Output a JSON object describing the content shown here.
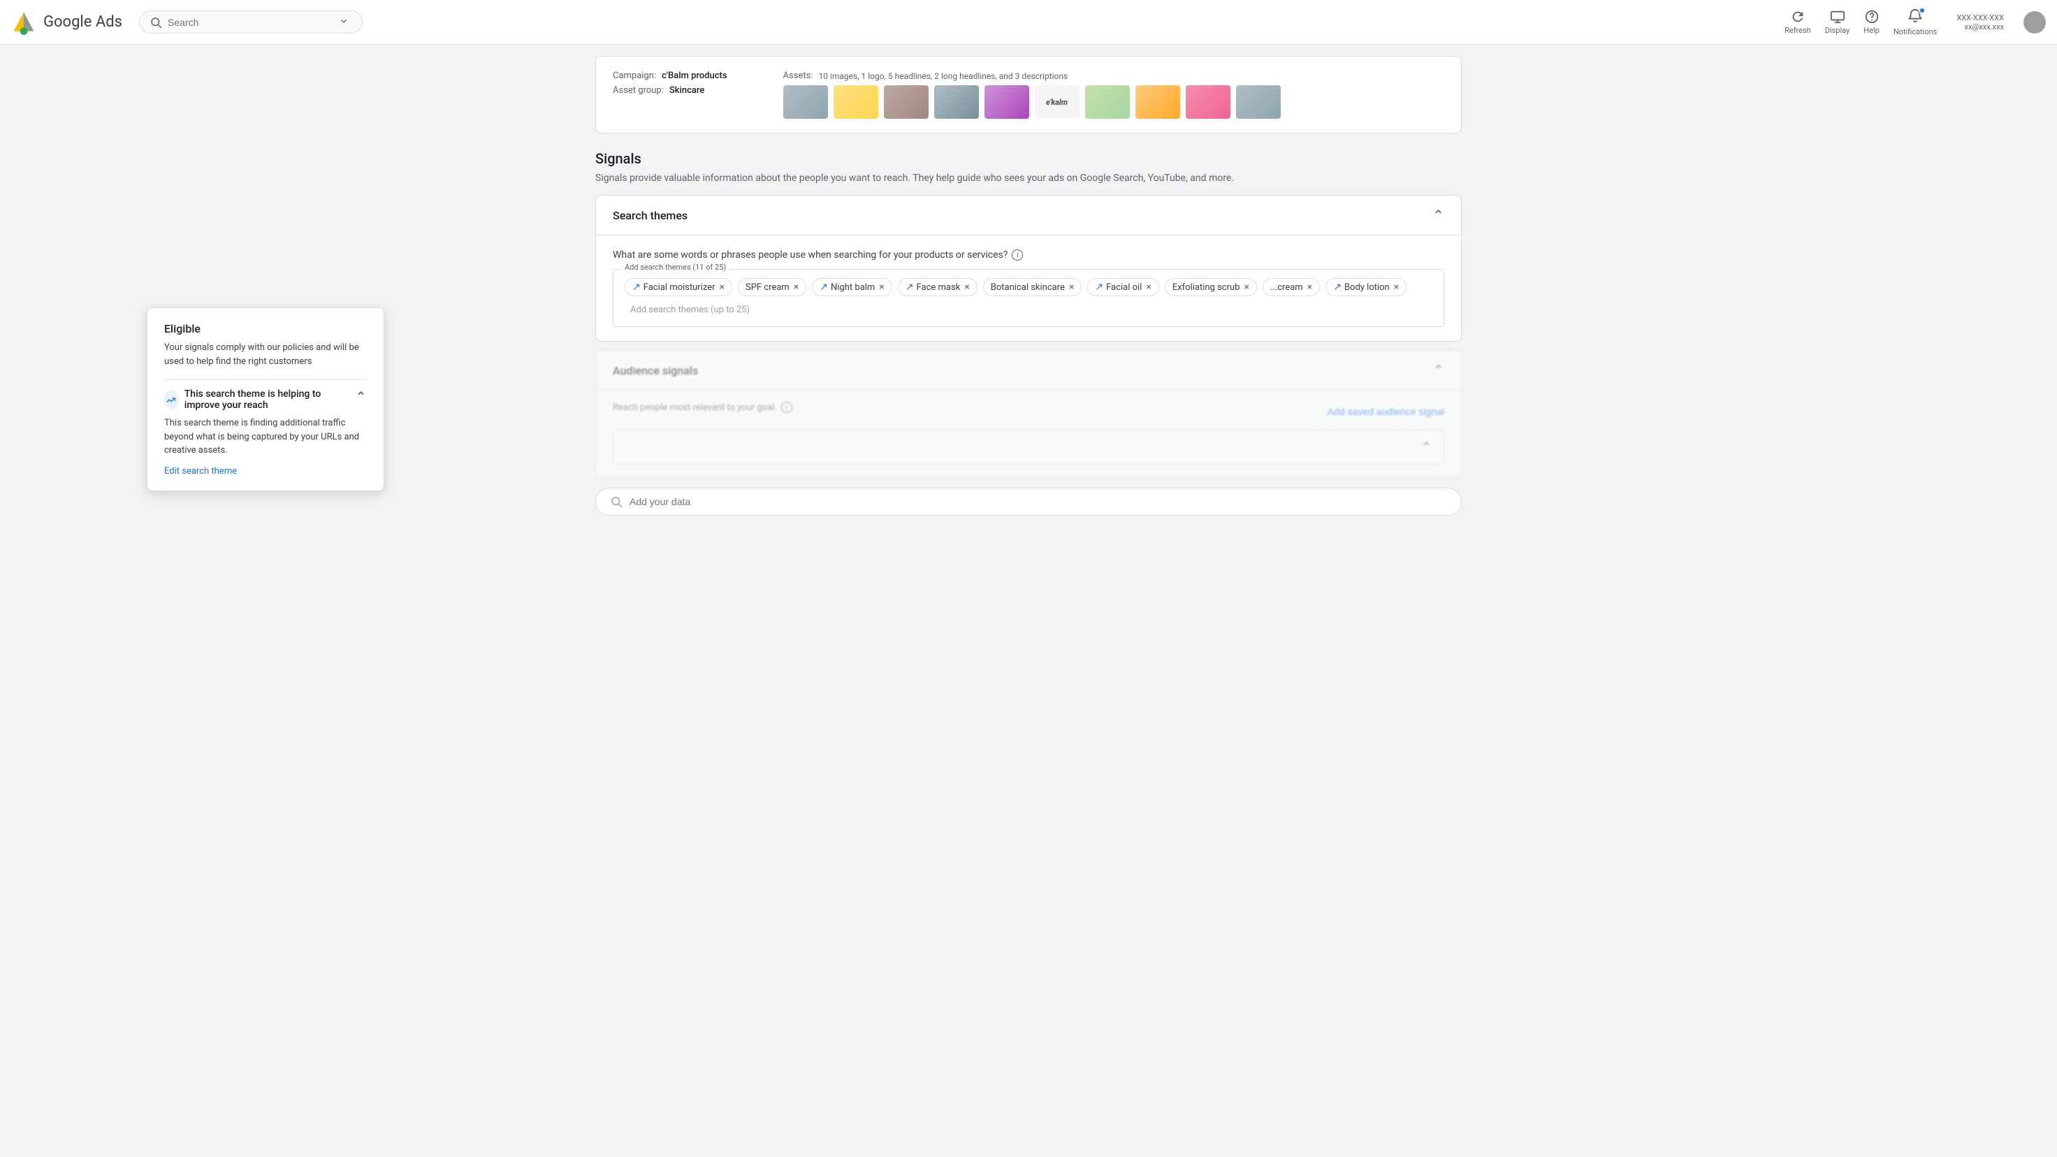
{
  "nav": {
    "logo_alt": "Google Ads Logo",
    "title": "Google Ads",
    "search_placeholder": "Search",
    "refresh_label": "Refresh",
    "display_label": "Display",
    "help_label": "Help",
    "notifications_label": "Notifications",
    "account_id_line1": "XXX-XXX-XXX",
    "account_id_line2": "xx@xxx.xxx"
  },
  "campaign": {
    "campaign_label": "Campaign:",
    "campaign_value": "c'Balm products",
    "asset_group_label": "Asset group:",
    "asset_group_value": "Skincare",
    "assets_label": "Assets:",
    "assets_description": "10 images, 1 logo, 5 headlines, 2 long headlines, and 3 descriptions"
  },
  "signals": {
    "title": "Signals",
    "description": "Signals provide valuable information about the people you want to reach. They help guide who sees your ads on Google Search, YouTube, and more.",
    "search_themes_title": "Search themes",
    "search_themes_question": "What are some words or phrases people use when searching for your products or services?",
    "tags_label": "Add search themes (11 of 25)",
    "tags_row1": [
      {
        "id": "t1",
        "label": "Facial moisturizer",
        "has_trend": true
      },
      {
        "id": "t2",
        "label": "SPF cream",
        "has_trend": false
      },
      {
        "id": "t3",
        "label": "Night balm",
        "has_trend": true
      },
      {
        "id": "t4",
        "label": "Face mask",
        "has_trend": true
      },
      {
        "id": "t5",
        "label": "Botanical skincare",
        "has_trend": false
      },
      {
        "id": "t6",
        "label": "Facial oil",
        "has_trend": true
      },
      {
        "id": "t7",
        "label": "Exfoliating scrub",
        "has_trend": false
      }
    ],
    "tags_row2": [
      {
        "id": "t8",
        "label": "...cream",
        "has_trend": false
      },
      {
        "id": "t9",
        "label": "Body lotion",
        "has_trend": true
      }
    ],
    "add_themes_placeholder": "Add search themes (up to 25)",
    "audience_signals_title": "Audience signals",
    "reach_description": "Reach people most relevant to your goal.",
    "add_saved_signal_btn": "Add saved audience signal"
  },
  "tooltip": {
    "title": "Eligible",
    "body": "Your signals comply with our policies and will be used to help find the right customers",
    "section_title": "This search theme is helping to improve your reach",
    "section_body": "This search theme is finding additional traffic beyond what is being captured by your URLs and creative assets.",
    "edit_link": "Edit search theme"
  },
  "bottom_search": {
    "placeholder": "Add your data"
  }
}
